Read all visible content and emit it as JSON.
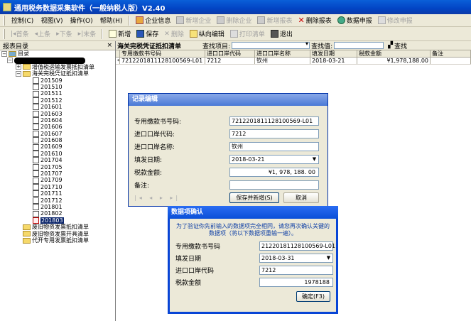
{
  "window": {
    "title": "通用税务数据采集软件（一般纳税人版）V2.40"
  },
  "menu": {
    "items": [
      "控制(C)",
      "视图(V)",
      "操作(O)",
      "帮助(H)"
    ],
    "actions": [
      {
        "label": "企业信息",
        "enabled": true
      },
      {
        "label": "新增企业",
        "enabled": false
      },
      {
        "label": "删除企业",
        "enabled": false
      },
      {
        "label": "新增报表",
        "enabled": false
      },
      {
        "label": "删除报表",
        "enabled": true
      },
      {
        "label": "数据申报",
        "enabled": true
      },
      {
        "label": "修改申报",
        "enabled": false
      }
    ]
  },
  "toolbar": {
    "items": [
      {
        "label": "首条",
        "enabled": false
      },
      {
        "label": "上条",
        "enabled": false
      },
      {
        "label": "下条",
        "enabled": false
      },
      {
        "label": "末条",
        "enabled": false
      },
      {
        "label": "新增",
        "enabled": true
      },
      {
        "label": "保存",
        "enabled": true
      },
      {
        "label": "删除",
        "enabled": false
      },
      {
        "label": "纵向编辑",
        "enabled": true
      },
      {
        "label": "打印清单",
        "enabled": false
      },
      {
        "label": "退出",
        "enabled": true
      }
    ]
  },
  "left_panel": {
    "header": "报表目录",
    "close": "×",
    "root": "目录",
    "groups": [
      "增值税运输发票抵扣清单",
      "海关完税凭证抵扣清单"
    ],
    "periods": [
      "201509",
      "201510",
      "201511",
      "201512",
      "201601",
      "201603",
      "201604",
      "201606",
      "201607",
      "201608",
      "201609",
      "201610",
      "201704",
      "201705",
      "201707",
      "201709",
      "201710",
      "201711",
      "201712",
      "201801",
      "201802",
      "201803"
    ],
    "selected_period": "201803",
    "other_groups": [
      "废旧物资发票抵扣清单",
      "废旧物资发票开具清单",
      "代开专用发票抵扣清单"
    ]
  },
  "main": {
    "title": "海关完税凭证抵扣清单",
    "search_item_label": "查找项目:",
    "search_value_label": "查找值:",
    "search_button": "查找",
    "columns": [
      "专用缴款书号码",
      "进口口岸代码",
      "进口口岸名称",
      "填发日期",
      "税款金额",
      "备注"
    ],
    "rows": [
      [
        "7212201811128100569-L01",
        "7212",
        "钦州",
        "2018-03-21",
        "¥1,978,188.00",
        ""
      ]
    ]
  },
  "record_dialog": {
    "title": "记录编辑",
    "fields": [
      {
        "label": "专用缴款书号码:",
        "value": "7212201811128100569-L01"
      },
      {
        "label": "进口口岸代码:",
        "value": "7212"
      },
      {
        "label": "进口口岸名称:",
        "value": "钦州"
      },
      {
        "label": "填发日期:",
        "value": "2018-03-21"
      },
      {
        "label": "税款金额:",
        "value": "¥1, 978, 188. 00"
      },
      {
        "label": "备注:",
        "value": ""
      }
    ],
    "save_button": "保存并新增(S)",
    "cancel_button": "取消"
  },
  "confirm_dialog": {
    "title": "数据项确认",
    "notice": "为了验证你先前输入的数据项完全相同，请您再次确认关键的数据项（将以下数据项重输一遍）。",
    "fields": [
      {
        "label": "专用缴款书号码",
        "value": "2122018112810056​9-L01"
      },
      {
        "label": "填发日期",
        "value": "2018-03-31"
      },
      {
        "label": "进口口岸代码",
        "value": "7212"
      },
      {
        "label": "税款金额",
        "value": "1978188"
      }
    ],
    "ok_button": "确定(F3)"
  }
}
